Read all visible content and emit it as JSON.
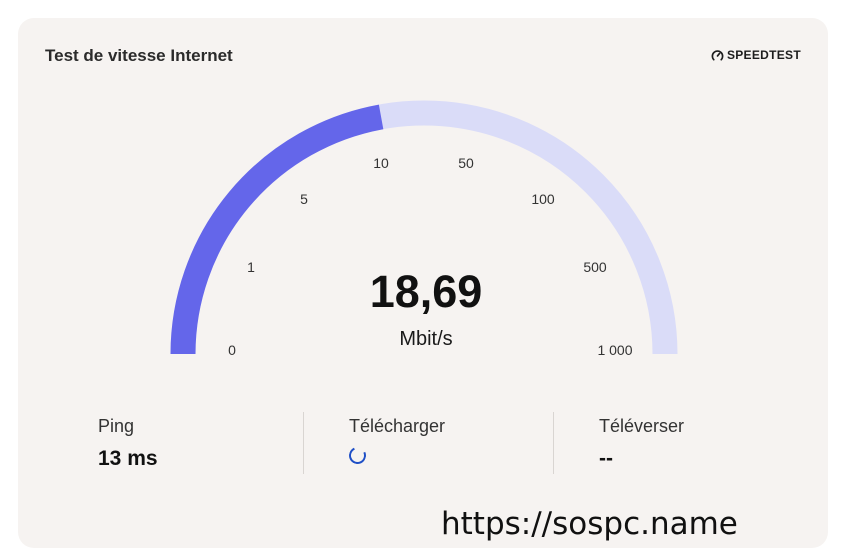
{
  "widget": {
    "title": "Test de vitesse Internet",
    "logo_text": "SPEEDTEST",
    "logo_icon": "speedometer-icon"
  },
  "gauge": {
    "value": "18,69",
    "unit": "Mbit/s",
    "fill_fraction": 0.443,
    "ticks": [
      "0",
      "1",
      "5",
      "10",
      "50",
      "100",
      "500",
      "1 000"
    ],
    "colors": {
      "fill": "#6466ea",
      "track": "#dadcf8"
    }
  },
  "metrics": {
    "ping": {
      "label": "Ping",
      "value": "13 ms"
    },
    "download": {
      "label": "Télécharger",
      "status": "loading-spinner-icon"
    },
    "upload": {
      "label": "Téléverser",
      "value": "--"
    }
  },
  "watermark": "https://sospc.name"
}
